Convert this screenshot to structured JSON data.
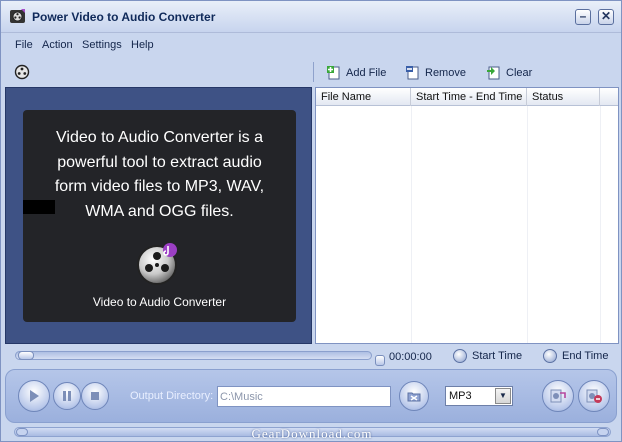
{
  "window": {
    "title": "Power Video to Audio Converter"
  },
  "title_buttons": {
    "minimize_glyph": "–",
    "close_glyph": "✕"
  },
  "menu": [
    "File",
    "Action",
    "Settings",
    "Help"
  ],
  "toolbar": {
    "add_file": "Add File",
    "remove": "Remove",
    "clear": "Clear"
  },
  "preview": {
    "description": "Video to Audio Converter is a powerful tool to extract audio form video files to MP3, WAV, WMA and OGG files.",
    "caption": "Video to Audio Converter"
  },
  "file_list": {
    "columns": [
      "File Name",
      "Start Time - End Time",
      "Status"
    ],
    "rows": []
  },
  "seek": {
    "time": "00:00:00",
    "start_time_label": "Start Time",
    "end_time_label": "End Time"
  },
  "output": {
    "label": "Output Directory:",
    "directory": "C:\\Music",
    "format": "MP3"
  },
  "watermark": "GearDownload.com",
  "colors": {
    "window_bg": "#c9d6ee",
    "preview_bg": "#3e5285",
    "preview_box": "#232428",
    "accent": "#7d8fb8"
  }
}
